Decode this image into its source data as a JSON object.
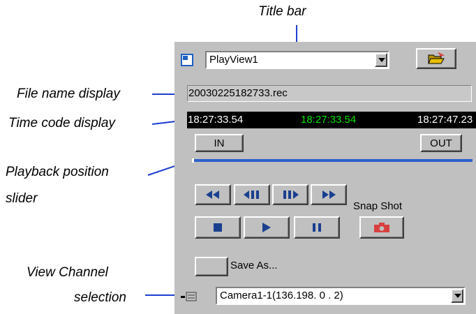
{
  "annotations": {
    "title_bar": "Title bar",
    "file_name_display": "File name display",
    "time_code_display": "Time code display",
    "playback_slider_line1": "Playback position",
    "playback_slider_line2": "slider",
    "view_channel_line1": "View Channel",
    "view_channel_line2": "selection"
  },
  "player": {
    "view_selector": "PlayView1",
    "file_name": "20030225182733.rec",
    "time_start": "18:27:33.54",
    "time_current": "18:27:33.54",
    "time_end": "18:27:47.23",
    "in_label": "IN",
    "out_label": "OUT",
    "playback_position": 0.0,
    "snapshot_label": "Snap Shot",
    "save_as_label": "Save As...",
    "channel_selector": "Camera1-1(136.198. 0 . 2)"
  },
  "colors": {
    "panel_bg": "#c0c0c0",
    "time_current": "#00e000",
    "slider": "#2e5fcc",
    "transport_icons": "#1a3f8f",
    "snapshot_icon": "#d8403f",
    "open_folder": "#e8c000"
  }
}
